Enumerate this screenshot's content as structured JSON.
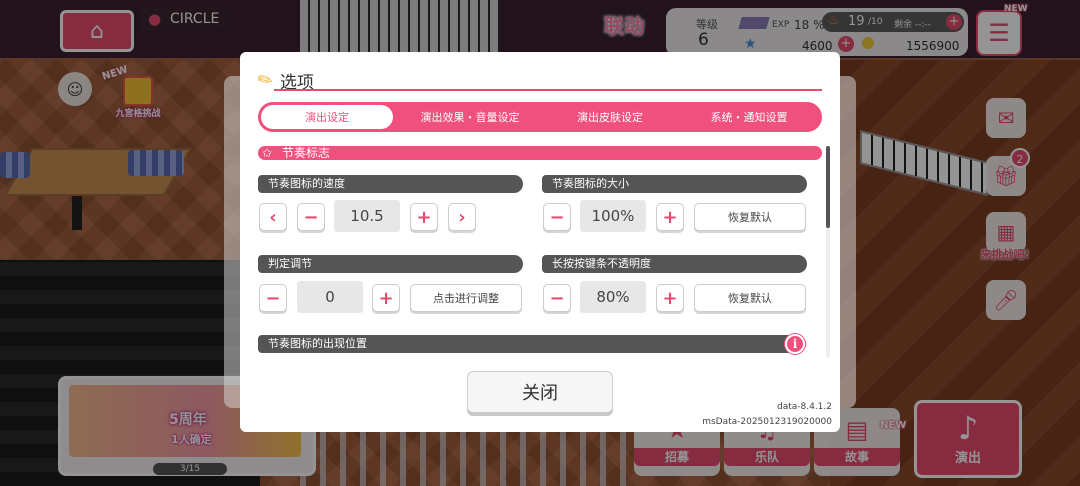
{
  "hud": {
    "location": "CIRCLE",
    "gift_event": {
      "new_tag": "NEW",
      "caption": "九宫格挑战"
    },
    "collab_banner": "联动",
    "level_label": "等级",
    "level_value": "6",
    "exp_label": "EXP",
    "exp_percent": "18 %",
    "ap_value": "19",
    "ap_max": "/10",
    "ap_timer": "剩余 --:--",
    "star_value": "4600",
    "coin_value": "1556900",
    "menu_new": "NEW",
    "side_badge": "2",
    "side_caption": "来挑战吧!"
  },
  "bottom": {
    "banner_title": "5周年",
    "banner_sub": "1人确定",
    "banner_pager": "3/15",
    "gacha": "招募",
    "band": "乐队",
    "story": "故事",
    "live": "演出",
    "new_tag": "NEW"
  },
  "dialog": {
    "title": "选项",
    "tabs": [
      "演出设定",
      "演出效果・音量设定",
      "演出皮肤设定",
      "系统・通知设置"
    ],
    "active_tab": 0,
    "section": "节奏标志",
    "speed": {
      "label": "节奏图标的速度",
      "prev": "‹",
      "minus": "−",
      "value": "10.5",
      "plus": "+",
      "next": "›"
    },
    "size": {
      "label": "节奏图标的大小",
      "minus": "−",
      "value": "100%",
      "plus": "+",
      "reset": "恢复默认"
    },
    "judge": {
      "label": "判定调节",
      "minus": "−",
      "value": "0",
      "plus": "+",
      "adjust": "点击进行调整"
    },
    "opacity": {
      "label": "长按按键条不透明度",
      "minus": "−",
      "value": "80%",
      "plus": "+",
      "reset": "恢复默认"
    },
    "position": {
      "label": "节奏图标的出现位置",
      "info": "i"
    },
    "close": "关闭",
    "version_data": "data-8.4.1.2",
    "version_ms": "msData-2025012319020000"
  },
  "colors": {
    "accent": "#f0507d",
    "label_bg": "#555555"
  }
}
